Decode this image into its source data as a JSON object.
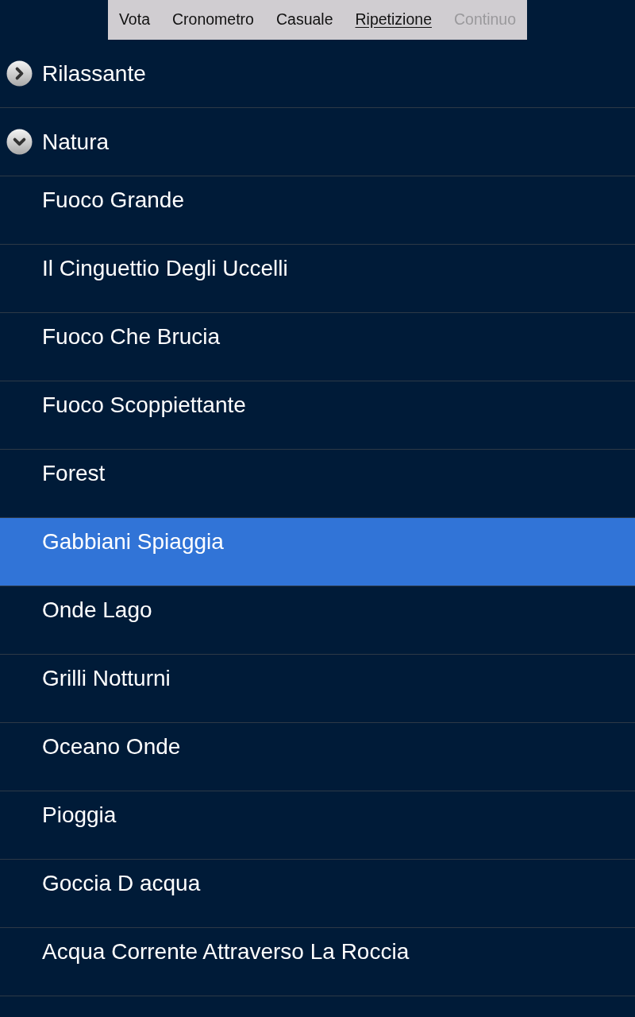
{
  "menu": [
    {
      "label": "Vota",
      "selected": false,
      "disabled": false
    },
    {
      "label": "Cronometro",
      "selected": false,
      "disabled": false
    },
    {
      "label": "Casuale",
      "selected": false,
      "disabled": false
    },
    {
      "label": "Ripetizione",
      "selected": true,
      "disabled": false
    },
    {
      "label": "Continuo",
      "selected": false,
      "disabled": true
    }
  ],
  "groups": [
    {
      "label": "Rilassante",
      "expanded": false
    },
    {
      "label": "Natura",
      "expanded": true,
      "children": [
        {
          "label": "Fuoco Grande",
          "selected": false
        },
        {
          "label": "Il Cinguettio Degli Uccelli",
          "selected": false
        },
        {
          "label": "Fuoco Che Brucia",
          "selected": false
        },
        {
          "label": "Fuoco Scoppiettante",
          "selected": false
        },
        {
          "label": "Forest",
          "selected": false
        },
        {
          "label": "Gabbiani Spiaggia",
          "selected": true
        },
        {
          "label": "Onde Lago",
          "selected": false
        },
        {
          "label": "Grilli Notturni",
          "selected": false
        },
        {
          "label": "Oceano Onde",
          "selected": false
        },
        {
          "label": "Pioggia",
          "selected": false
        },
        {
          "label": "Goccia D acqua",
          "selected": false
        },
        {
          "label": "Acqua Corrente Attraverso La Roccia",
          "selected": false
        }
      ]
    }
  ]
}
